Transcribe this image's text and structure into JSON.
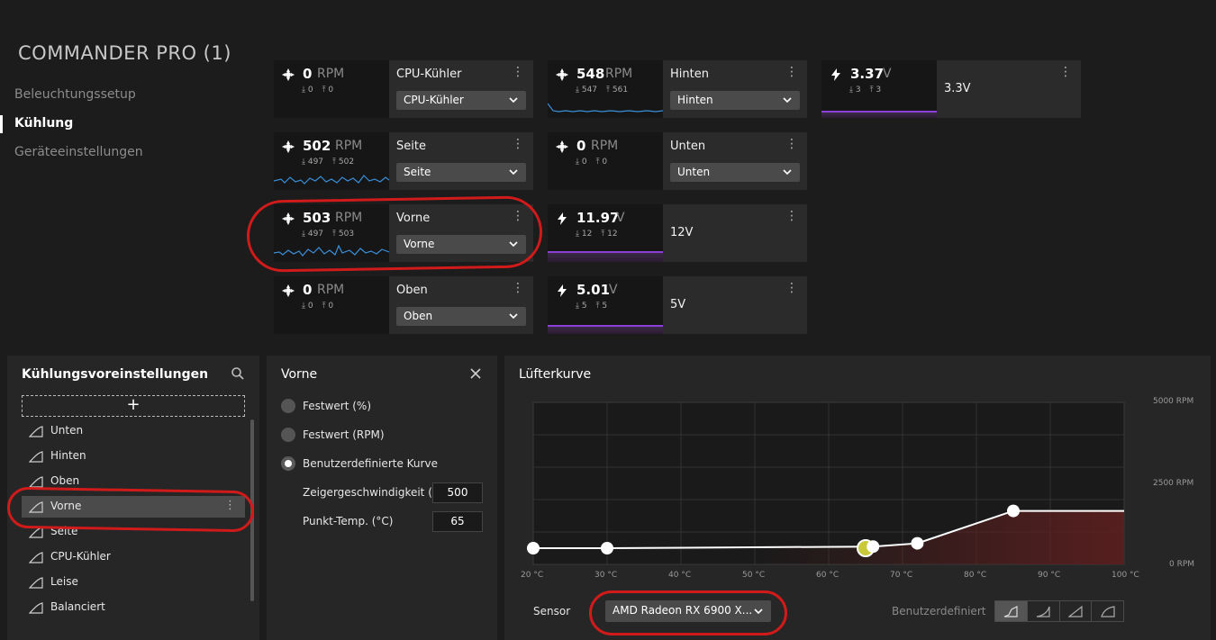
{
  "device": {
    "title": "COMMANDER PRO (1)"
  },
  "nav": {
    "items": [
      {
        "label": "Beleuchtungssetup",
        "active": false
      },
      {
        "label": "Kühlung",
        "active": true
      },
      {
        "label": "Geräteeinstellungen",
        "active": false
      }
    ]
  },
  "tiles": {
    "cpu": {
      "value": "0",
      "unit": "RPM",
      "min": "0",
      "max": "0",
      "name": "CPU-Kühler",
      "select": "CPU-Kühler"
    },
    "seite": {
      "value": "502",
      "unit": "RPM",
      "min": "497",
      "max": "502",
      "name": "Seite",
      "select": "Seite"
    },
    "vorne": {
      "value": "503",
      "unit": "RPM",
      "min": "497",
      "max": "503",
      "name": "Vorne",
      "select": "Vorne"
    },
    "oben": {
      "value": "0",
      "unit": "RPM",
      "min": "0",
      "max": "0",
      "name": "Oben",
      "select": "Oben"
    },
    "hinten": {
      "value": "548",
      "unit": "RPM",
      "min": "547",
      "max": "561",
      "name": "Hinten",
      "select": "Hinten"
    },
    "unten": {
      "value": "0",
      "unit": "RPM",
      "min": "0",
      "max": "0",
      "name": "Unten",
      "select": "Unten"
    },
    "v12": {
      "value": "11.97",
      "unit": "V",
      "min": "12",
      "max": "12",
      "name": "12V"
    },
    "v5": {
      "value": "5.01",
      "unit": "V",
      "min": "5",
      "max": "5",
      "name": "5V"
    },
    "v33": {
      "value": "3.37",
      "unit": "V",
      "min": "3",
      "max": "3",
      "name": "3.3V"
    }
  },
  "presets": {
    "title": "Kühlungsvoreinstellungen",
    "add_label": "+",
    "items": [
      "Unten",
      "Hinten",
      "Oben",
      "Vorne",
      "Seite",
      "CPU-Kühler",
      "Leise",
      "Balanciert"
    ],
    "selected": "Vorne"
  },
  "detail": {
    "title": "Vorne",
    "options": [
      "Festwert (%)",
      "Festwert (RPM)",
      "Benutzerdefinierte Kurve"
    ],
    "selected_option": "Benutzerdefinierte Kurve",
    "speed_label": "Zeigergeschwindigkeit (RF",
    "speed_value": "500",
    "temp_label": "Punkt-Temp. (°C)",
    "temp_value": "65"
  },
  "curve": {
    "title": "Lüfterkurve",
    "sensor_label": "Sensor",
    "sensor_value": "AMD Radeon RX 6900 X...",
    "mode_label": "Benutzerdefiniert",
    "y_ticks": [
      "5000 RPM",
      "2500 RPM",
      "0 RPM"
    ],
    "x_ticks": [
      "20 °C",
      "30 °C",
      "40 °C",
      "50 °C",
      "60 °C",
      "70 °C",
      "80 °C",
      "90 °C",
      "100 °C"
    ],
    "active_mode_index": 0
  },
  "chart_data": {
    "type": "line",
    "title": "Lüfterkurve",
    "xlabel": "",
    "ylabel": "",
    "xlim": [
      20,
      100
    ],
    "ylim": [
      0,
      5000
    ],
    "series": [
      {
        "x": [
          20,
          30,
          66,
          72,
          85
        ],
        "y": [
          500,
          500,
          550,
          650,
          1650
        ]
      }
    ],
    "current_point": {
      "x": 65,
      "y": 500
    },
    "grid": true
  },
  "colors": {
    "accent_purple": "#8b3fd6",
    "spark_blue": "#3b8fd9",
    "annotation_red": "#d11a1a",
    "curve_fill": "#5a1f1f",
    "current_point": "#c9c93a"
  }
}
